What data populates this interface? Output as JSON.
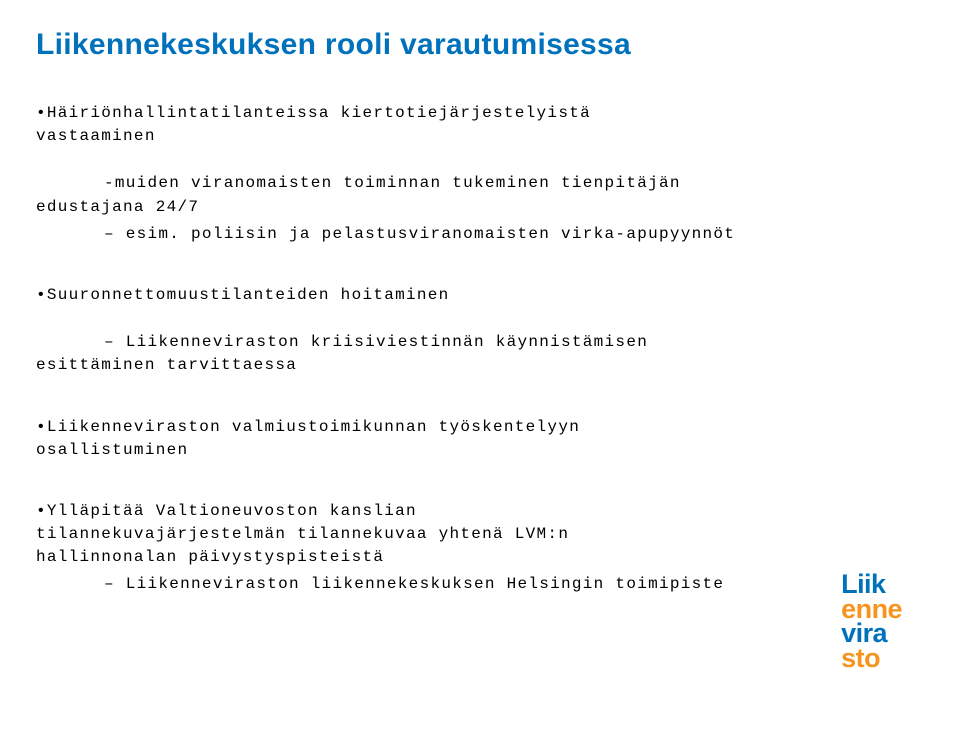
{
  "title": "Liikennekeskuksen rooli varautumisessa",
  "b1": {
    "l1": "•Häiriönhallintatilanteissa kiertotiejärjestelyistä",
    "l2": "vastaaminen",
    "sub1a": "-muiden viranomaisten toiminnan tukeminen tienpitäjän",
    "sub1b": "edustajana  24/7",
    "sub2": "– esim. poliisin ja pelastusviranomaisten virka-apupyynnöt"
  },
  "b2": {
    "l1": "•Suuronnettomuustilanteiden hoitaminen",
    "sub1a": "– Liikenneviraston kriisiviestinnän käynnistämisen",
    "sub1b": "esittäminen  tarvittaessa"
  },
  "b3": {
    "l1": "•Liikenneviraston valmiustoimikunnan työskentelyyn",
    "l2": "osallistuminen"
  },
  "b4": {
    "l1": "•Ylläpitää Valtioneuvoston kanslian",
    "l2": "tilannekuvajärjestelmän tilannekuvaa yhtenä LVM:n",
    "l3": "hallinnonalan päivystyspisteistä",
    "foot": "– Liikenneviraston liikennekeskuksen Helsingin toimipiste"
  },
  "logo": {
    "r1a": "Liik",
    "r2a": "enne",
    "r3a": "vira",
    "r3b": "sto"
  }
}
